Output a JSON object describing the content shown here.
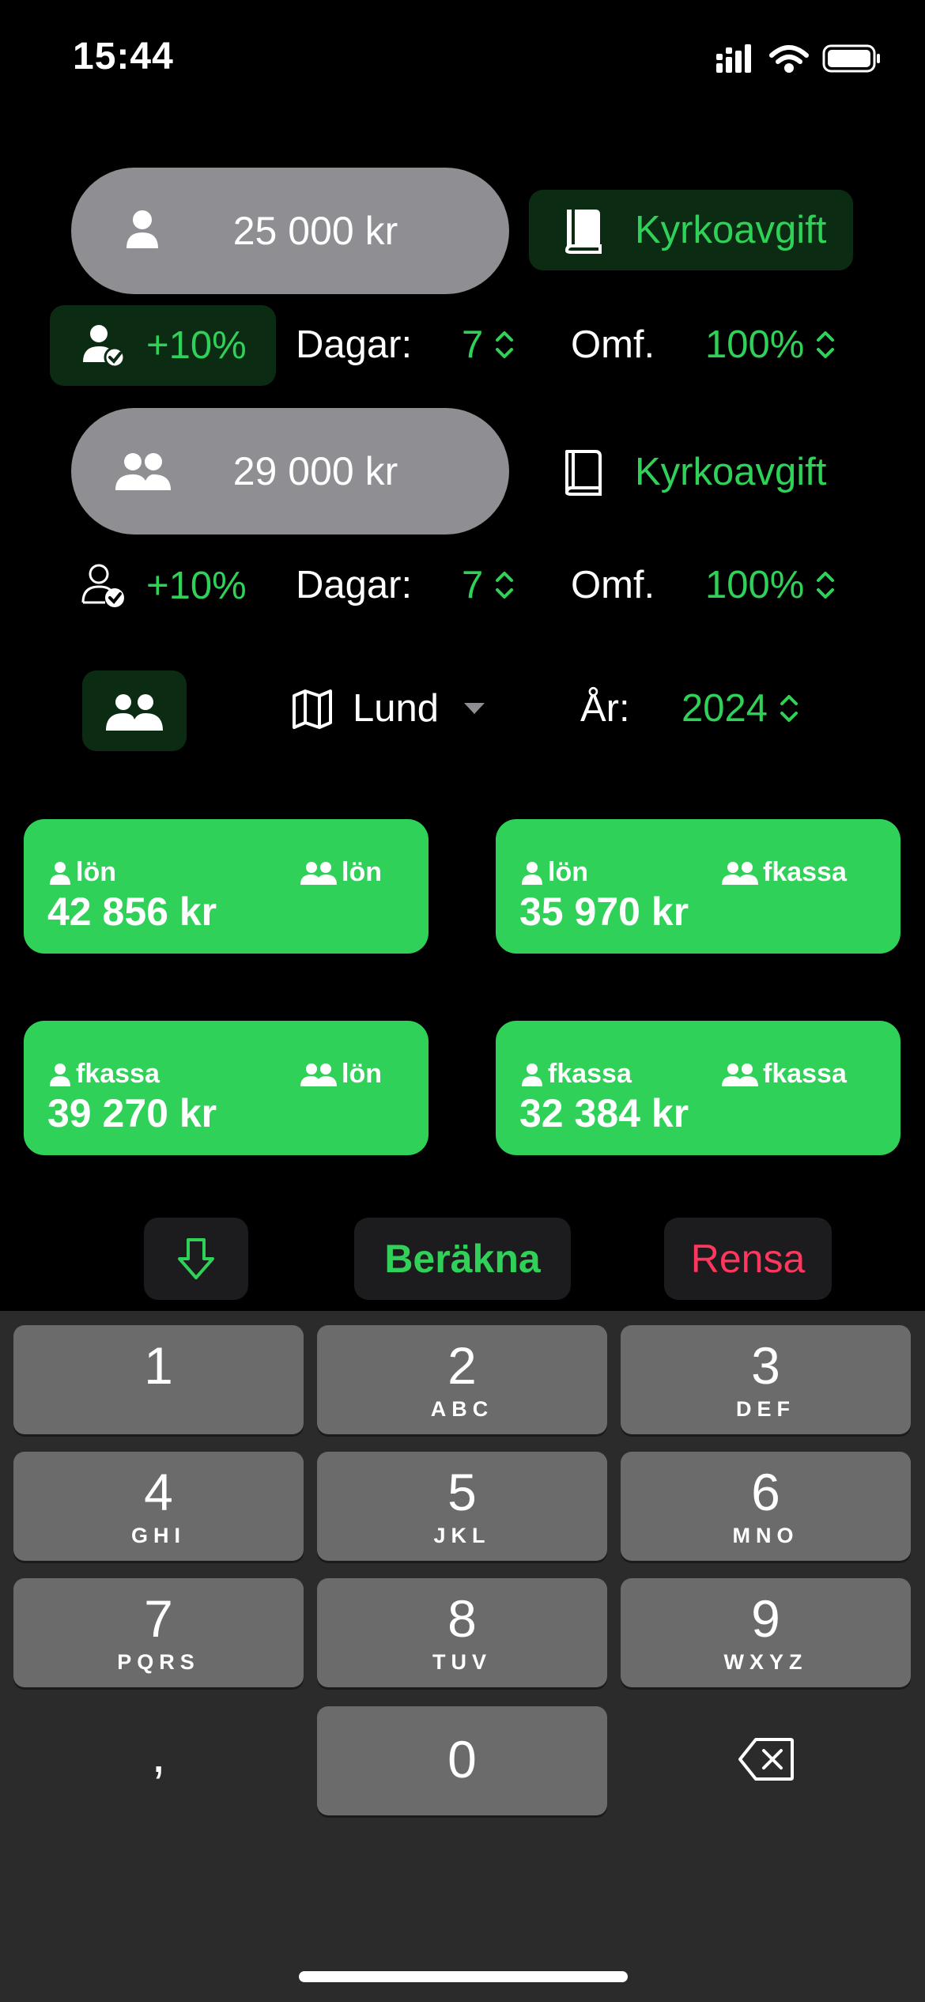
{
  "status_bar": {
    "time": "15:44"
  },
  "person1": {
    "salary": "25 000 kr",
    "church_fee_label": "Kyrkoavgift",
    "bonus_label": "+10%",
    "days_label": "Dagar:",
    "days_value": "7",
    "scope_label": "Omf.",
    "scope_value": "100%"
  },
  "person2": {
    "salary": "29 000 kr",
    "church_fee_label": "Kyrkoavgift",
    "bonus_label": "+10%",
    "days_label": "Dagar:",
    "days_value": "7",
    "scope_label": "Omf.",
    "scope_value": "100%"
  },
  "settings": {
    "region": "Lund",
    "year_label": "År:",
    "year_value": "2024"
  },
  "results": [
    {
      "p1": "lön",
      "p2": "lön",
      "amount": "42 856 kr"
    },
    {
      "p1": "lön",
      "p2": "fkassa",
      "amount": "35 970 kr"
    },
    {
      "p1": "fkassa",
      "p2": "lön",
      "amount": "39 270 kr"
    },
    {
      "p1": "fkassa",
      "p2": "fkassa",
      "amount": "32 384 kr"
    }
  ],
  "actions": {
    "calculate": "Beräkna",
    "clear": "Rensa"
  },
  "keyboard": {
    "keys": [
      {
        "digit": "1",
        "letters": ""
      },
      {
        "digit": "2",
        "letters": "ABC"
      },
      {
        "digit": "3",
        "letters": "DEF"
      },
      {
        "digit": "4",
        "letters": "GHI"
      },
      {
        "digit": "5",
        "letters": "JKL"
      },
      {
        "digit": "6",
        "letters": "MNO"
      },
      {
        "digit": "7",
        "letters": "PQRS"
      },
      {
        "digit": "8",
        "letters": "TUV"
      },
      {
        "digit": "9",
        "letters": "WXYZ"
      },
      {
        "digit": "0",
        "letters": ""
      }
    ],
    "decimal": ","
  },
  "colors": {
    "accent_green": "#30d158",
    "dark_green_bg": "#0c2b13",
    "clear_red": "#ff375f",
    "pill_gray": "#8e8e93",
    "key_gray": "#6b6b6b"
  },
  "icons": {
    "person": "person-icon",
    "people": "people-icon",
    "book": "book-icon",
    "person-check": "person-check-icon",
    "map": "map-icon",
    "arrow-down": "arrow-down-icon",
    "delete": "delete-backspace-icon"
  }
}
